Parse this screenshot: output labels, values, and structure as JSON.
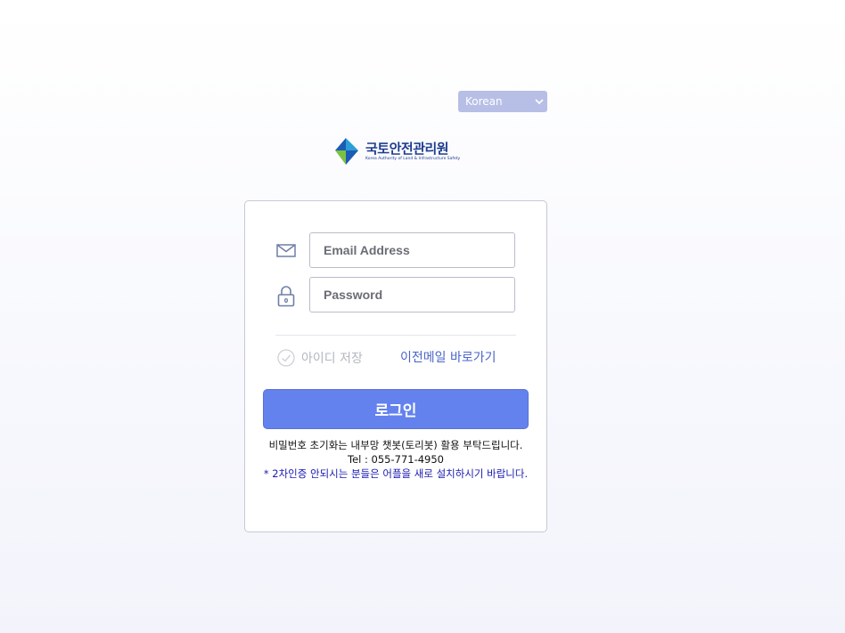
{
  "language": {
    "selected": "Korean"
  },
  "logo": {
    "name": "국토안전관리원",
    "subtitle": "Korea Authority of Land & Infrastructure Safety",
    "colors": {
      "green": "#7cc242",
      "blue": "#1d5bb5",
      "cyan": "#2a9fd6",
      "navy": "#1d3c8f"
    }
  },
  "login": {
    "email_placeholder": "Email Address",
    "password_placeholder": "Password",
    "remember_label": "아이디 저장",
    "prev_mail_link": "이전메일 바로가기",
    "button_label": "로그인",
    "notice": "비밀번호 초기화는 내부망 챗봇(토리봇) 활용 부탁드립니다.",
    "tel": "Tel : 055-771-4950",
    "otp_notice": "* 2차인증 안되시는 분들은 어플을 새로 설치하시기 바랍니다."
  },
  "icons": {
    "email": "mail-icon",
    "password": "lock-icon",
    "remember": "check-circle-icon",
    "dropdown": "chevron-down-icon"
  },
  "colors": {
    "primary_button": "#6382ee",
    "link": "#4a64c9",
    "select_bg": "#b7bfe6",
    "otp_notice": "#1a1ab0"
  }
}
